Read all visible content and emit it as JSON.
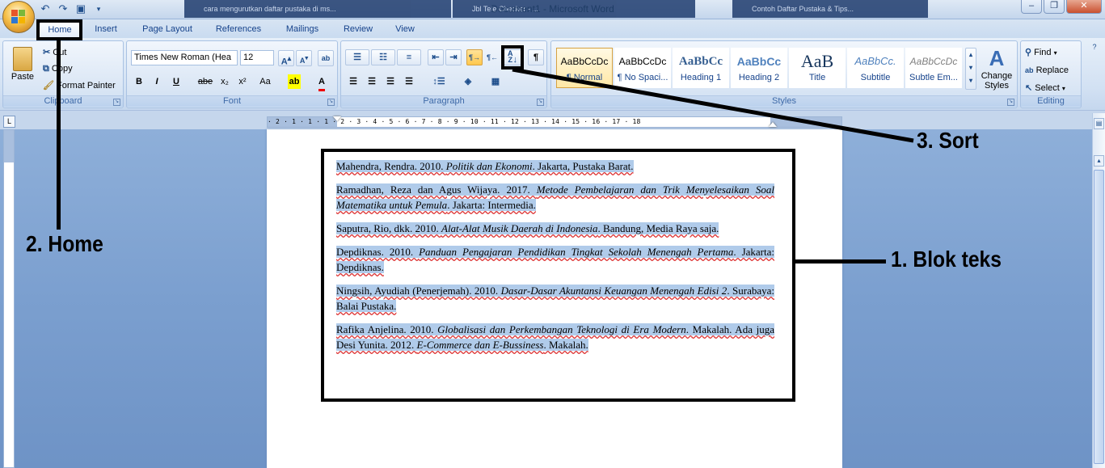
{
  "window": {
    "title": "Document1 - Microsoft Word",
    "taskbar_ghosts": [
      "cara mengurutkan daftar pustaka di ms...",
      "Jbl Tele Checker - ...",
      "Contoh Daftar Pustaka & Tips..."
    ]
  },
  "tabs": [
    "Home",
    "Insert",
    "Page Layout",
    "References",
    "Mailings",
    "Review",
    "View"
  ],
  "ribbon": {
    "clipboard": {
      "label": "Clipboard",
      "paste": "Paste",
      "cut": "Cut",
      "copy": "Copy",
      "format_painter": "Format Painter"
    },
    "font": {
      "label": "Font",
      "font_name": "Times New Roman (Hea",
      "font_size": "12",
      "bold": "B",
      "italic": "I",
      "underline": "U",
      "strike": "abe",
      "subscript": "x₂",
      "superscript": "x²",
      "change_case": "Aa"
    },
    "paragraph": {
      "label": "Paragraph"
    },
    "styles": {
      "label": "Styles",
      "items": [
        {
          "sample": "AaBbCcDc",
          "name": "¶ Normal"
        },
        {
          "sample": "AaBbCcDc",
          "name": "¶ No Spaci..."
        },
        {
          "sample": "AaBbCc",
          "name": "Heading 1"
        },
        {
          "sample": "AaBbCc",
          "name": "Heading 2"
        },
        {
          "sample": "AaB",
          "name": "Title"
        },
        {
          "sample": "AaBbCc.",
          "name": "Subtitle"
        },
        {
          "sample": "AaBbCcDc",
          "name": "Subtle Em..."
        }
      ],
      "change_styles": "Change Styles"
    },
    "editing": {
      "label": "Editing",
      "find": "Find",
      "replace": "Replace",
      "select": "Select"
    }
  },
  "ruler": {
    "corner": "L",
    "ticks": "· 2 · 1 · 1 · 1 · 2 · 3 · 4 · 5 · 6 · 7 · 8 · 9 · 10 · 11 · 12 · 13 · 14 · 15 · 16 · 17 · 18"
  },
  "document": {
    "entries": [
      {
        "parts": [
          [
            "Mahendra, Rendra. 2010. ",
            "n"
          ],
          [
            "Politik dan Ekonomi",
            "i"
          ],
          [
            ". Jakarta, Pustaka Barat.",
            "n"
          ]
        ]
      },
      {
        "parts": [
          [
            "Ramadhan, Reza dan Agus Wijaya. 2017. ",
            "n"
          ],
          [
            "Metode Pembelajaran dan Trik Menyelesaikan Soal Matematika untuk Pemula",
            "i"
          ],
          [
            ". Jakarta: Intermedia.",
            "n"
          ]
        ]
      },
      {
        "parts": [
          [
            "Saputra, Rio, dkk. 2010. ",
            "n"
          ],
          [
            "Alat-Alat Musik Daerah di Indonesia",
            "i"
          ],
          [
            ". Bandung, Media Raya saja.",
            "n"
          ]
        ]
      },
      {
        "parts": [
          [
            "Depdiknas. 2010. ",
            "n"
          ],
          [
            "Panduan Pengajaran Pendidikan Tingkat Sekolah Menengah Pertama",
            "i"
          ],
          [
            ". Jakarta: Depdiknas.",
            "n"
          ]
        ]
      },
      {
        "parts": [
          [
            "Ningsih, Ayudiah (Penerjemah). 2010. ",
            "n"
          ],
          [
            "Dasar-Dasar Akuntansi Keuangan Menengah Edisi 2",
            "i"
          ],
          [
            ". Surabaya: Balai Pustaka.",
            "n"
          ]
        ]
      },
      {
        "parts": [
          [
            "Rafika Anjelina. 2010. ",
            "n"
          ],
          [
            "Globalisasi dan Perkembangan Teknologi di Era Modern",
            "i"
          ],
          [
            ". Makalah. Ada juga Desi Yunita. 2012. ",
            "n"
          ],
          [
            "E-Commerce dan E-Bussiness",
            "i"
          ],
          [
            ". Makalah.",
            "n"
          ]
        ]
      }
    ]
  },
  "annotations": {
    "step1": "1. Blok teks",
    "step2": "2. Home",
    "step3": "3. Sort"
  },
  "colors": {
    "selection": "#b0cbea",
    "ribbon": "#dae6f5",
    "workspace": "#7b9fcf",
    "annotation": "#000000"
  }
}
